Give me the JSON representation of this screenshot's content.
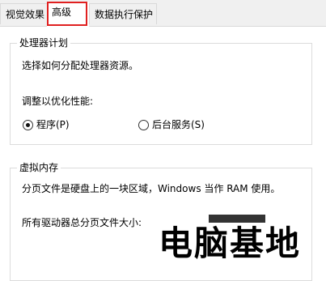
{
  "tabs": [
    {
      "label": "视觉效果"
    },
    {
      "label": "高级"
    },
    {
      "label": "数据执行保护"
    }
  ],
  "processor_group": {
    "title": "处理器计划",
    "description": "选择如何分配处理器资源。",
    "optimize_label": "调整以优化性能:",
    "options": [
      {
        "label": "程序(P)",
        "selected": true
      },
      {
        "label": "后台服务(S)",
        "selected": false
      }
    ]
  },
  "memory_group": {
    "title": "虚拟内存",
    "description": "分页文件是硬盘上的一块区域，Windows 当作 RAM 使用。",
    "total_label": "所有驱动器总分页文件大小:"
  },
  "watermark": "电脑基地"
}
